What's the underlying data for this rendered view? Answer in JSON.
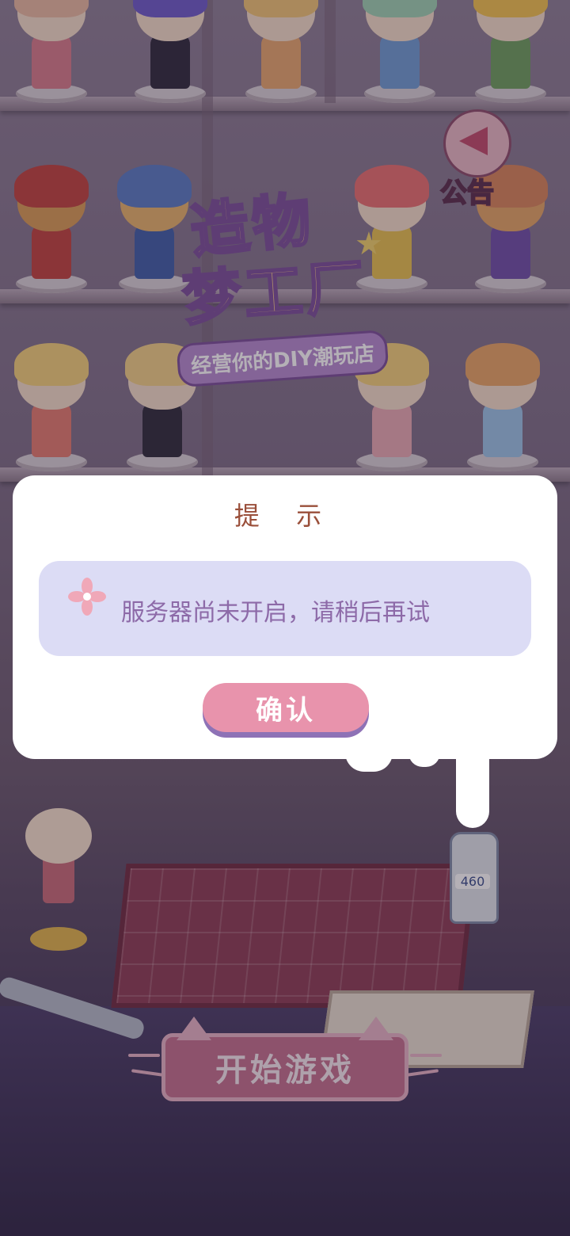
{
  "game": {
    "logo_title_line1": "造物",
    "logo_title_line2": "梦工厂",
    "logo_subtitle": "经营你的DIY潮玩店",
    "announcement_label": "公告",
    "start_button_label": "开始游戏",
    "glue_label": "460"
  },
  "dialog": {
    "title": "提 示",
    "message": "服务器尚未开启，请稍后再试",
    "confirm_label": "确认",
    "flower_icon": "flower-icon"
  },
  "colors": {
    "dialog_title": "#9a4f3a",
    "message_text": "#8d6aa8",
    "message_bg": "#dcdcf5",
    "confirm_button": "#e893ac",
    "confirm_shadow": "#8e72b6"
  }
}
